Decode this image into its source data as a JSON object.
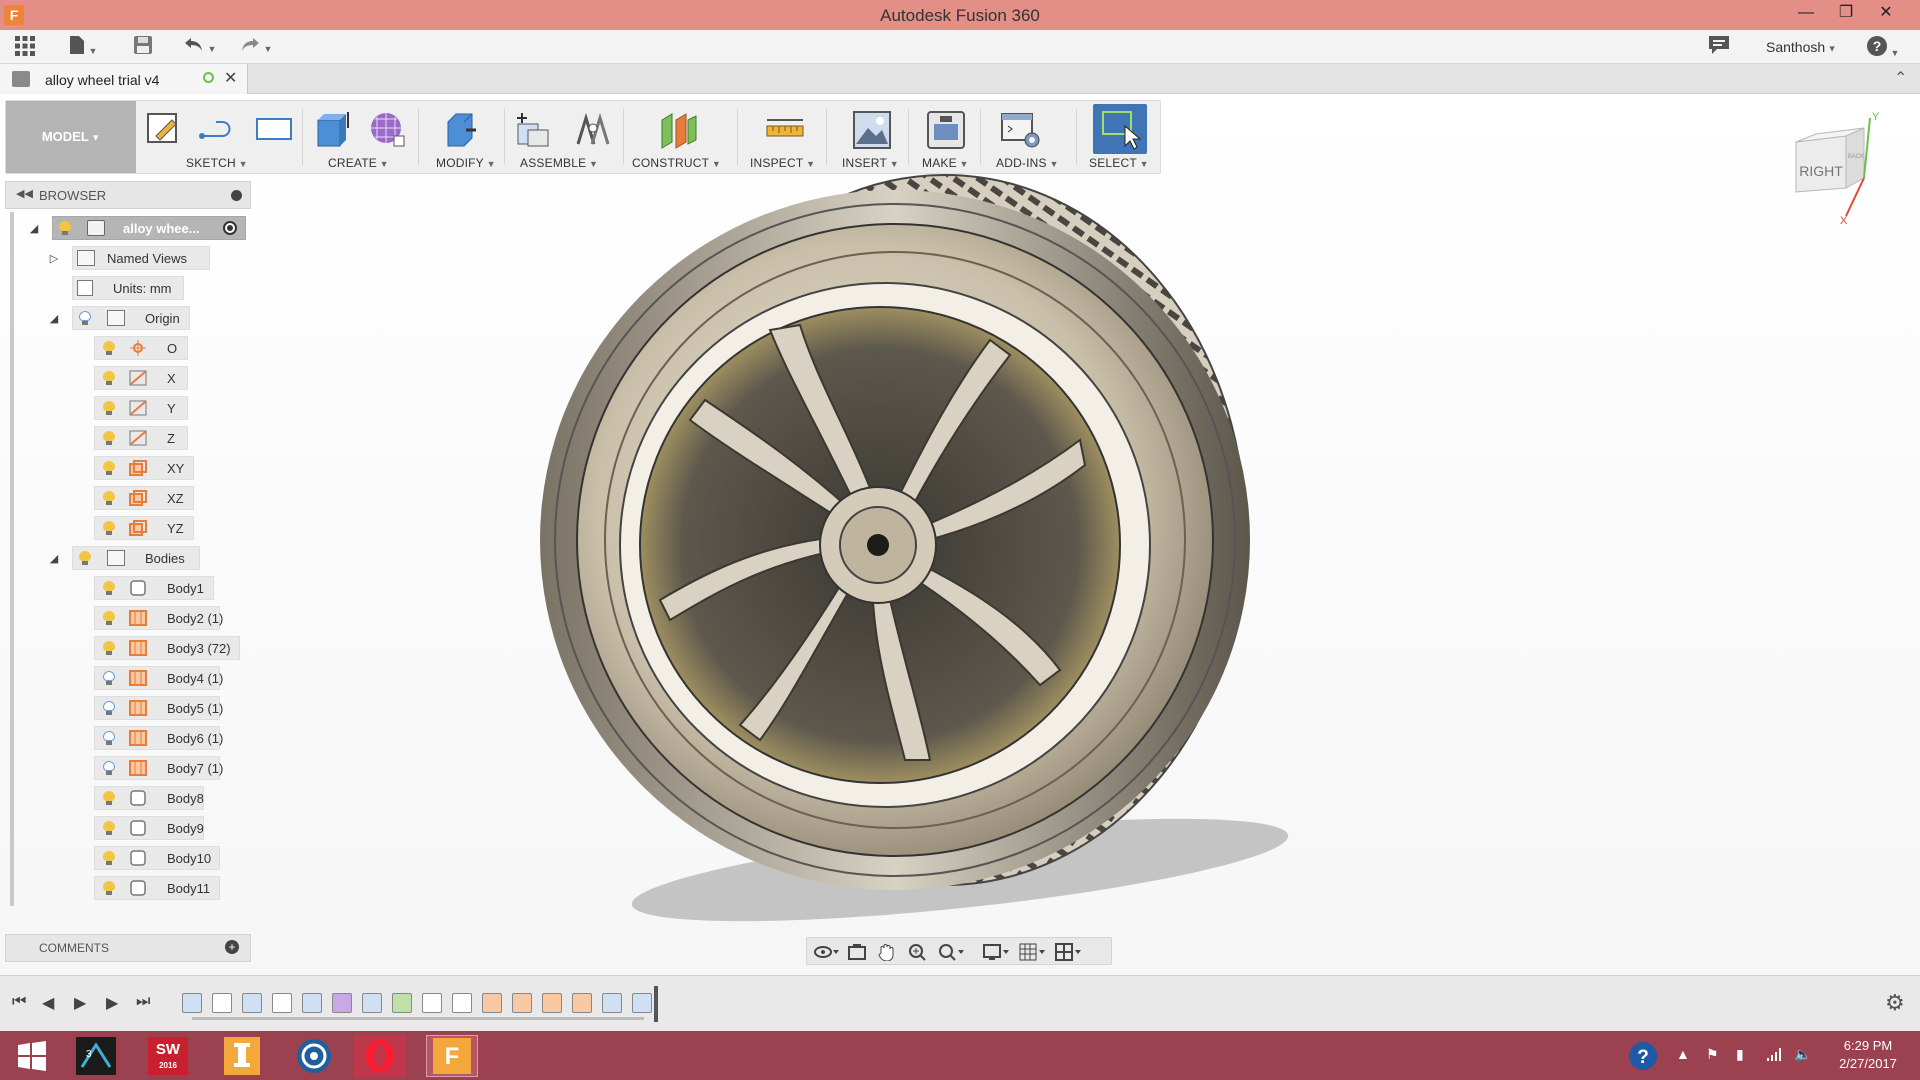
{
  "window": {
    "title": "Autodesk Fusion 360",
    "app_icon": "F",
    "controls": [
      "minimize-icon",
      "restore-icon",
      "close-icon"
    ]
  },
  "quick_access": {
    "user": "Santhosh",
    "icons": [
      "app-grid-icon",
      "file-icon",
      "save-icon",
      "undo-icon",
      "redo-icon",
      "comment-icon",
      "help-icon"
    ]
  },
  "document_tab": {
    "name": "alloy wheel trial v4"
  },
  "ribbon": {
    "workspace": "MODEL",
    "groups": [
      "SKETCH",
      "CREATE",
      "MODIFY",
      "ASSEMBLE",
      "CONSTRUCT",
      "INSPECT",
      "INSERT",
      "MAKE",
      "ADD-INS",
      "SELECT"
    ]
  },
  "viewcube": {
    "face": "RIGHT",
    "side": "BACK",
    "axes": [
      "Y",
      "X"
    ]
  },
  "browser": {
    "title": "BROWSER",
    "root": "alloy whee...",
    "named_views": "Named Views",
    "units": "Units: mm",
    "origin": {
      "label": "Origin",
      "items": [
        "O",
        "X",
        "Y",
        "Z",
        "XY",
        "XZ",
        "YZ"
      ]
    },
    "bodies": {
      "label": "Bodies",
      "items": [
        "Body1",
        "Body2 (1)",
        "Body3 (72)",
        "Body4 (1)",
        "Body5 (1)",
        "Body6 (1)",
        "Body7 (1)",
        "Body8",
        "Body9",
        "Body10",
        "Body11"
      ],
      "visible": [
        true,
        true,
        true,
        false,
        false,
        false,
        false,
        true,
        true,
        true,
        true
      ]
    }
  },
  "comments": {
    "title": "COMMENTS"
  },
  "timeline": {
    "controls": [
      "skip-start-icon",
      "step-back-icon",
      "step-forward-icon",
      "play-icon",
      "skip-end-icon"
    ],
    "feature_count": 16
  },
  "taskbar": {
    "apps": [
      "windows-start-icon",
      "3ds-max-icon",
      "solidworks-2016-icon",
      "inventor-pro-icon",
      "keyshot-icon",
      "opera-icon",
      "fusion-360-icon"
    ],
    "solidworks_label": "SW",
    "solidworks_year": "2016",
    "clock_time": "6:29 PM",
    "clock_date": "2/27/2017"
  }
}
